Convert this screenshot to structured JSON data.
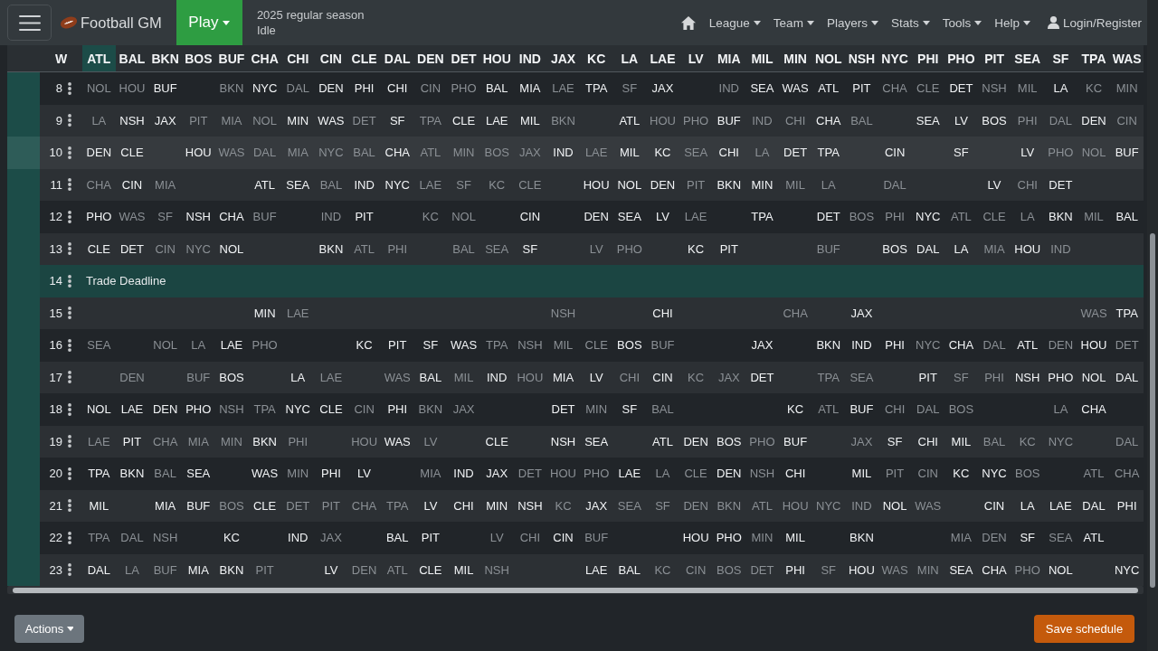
{
  "navbar": {
    "brand": "Football GM",
    "play": "Play",
    "season": "2025 regular season",
    "phase": "Idle",
    "menus": [
      "League",
      "Team",
      "Players",
      "Stats",
      "Tools",
      "Help"
    ],
    "login": "Login/Register"
  },
  "schedule": {
    "columns": [
      {
        "label": "W",
        "highlighted": false
      },
      {
        "label": "ATL",
        "highlighted": true
      },
      {
        "label": "BAL",
        "highlighted": false
      },
      {
        "label": "BKN",
        "highlighted": false
      },
      {
        "label": "BOS",
        "highlighted": false
      },
      {
        "label": "BUF",
        "highlighted": false
      },
      {
        "label": "CHA",
        "highlighted": false
      },
      {
        "label": "CHI",
        "highlighted": false
      },
      {
        "label": "CIN",
        "highlighted": false
      },
      {
        "label": "CLE",
        "highlighted": false
      },
      {
        "label": "DAL",
        "highlighted": false
      },
      {
        "label": "DEN",
        "highlighted": false
      },
      {
        "label": "DET",
        "highlighted": false
      },
      {
        "label": "HOU",
        "highlighted": false
      },
      {
        "label": "IND",
        "highlighted": false
      },
      {
        "label": "JAX",
        "highlighted": false
      },
      {
        "label": "KC",
        "highlighted": false
      },
      {
        "label": "LA",
        "highlighted": false
      },
      {
        "label": "LAE",
        "highlighted": false
      },
      {
        "label": "LV",
        "highlighted": false
      },
      {
        "label": "MIA",
        "highlighted": false
      },
      {
        "label": "MIL",
        "highlighted": false
      },
      {
        "label": "MIN",
        "highlighted": false
      },
      {
        "label": "NOL",
        "highlighted": false
      },
      {
        "label": "NSH",
        "highlighted": false
      },
      {
        "label": "NYC",
        "highlighted": false
      },
      {
        "label": "PHI",
        "highlighted": false
      },
      {
        "label": "PHO",
        "highlighted": false
      },
      {
        "label": "PIT",
        "highlighted": false
      },
      {
        "label": "SEA",
        "highlighted": false
      },
      {
        "label": "SF",
        "highlighted": false
      },
      {
        "label": "TPA",
        "highlighted": false
      },
      {
        "label": "WAS",
        "highlighted": false
      }
    ],
    "rows": [
      {
        "week": "8",
        "kind": "games",
        "hovered": false,
        "cells": [
          {
            "opponent": "NOL",
            "home": false
          },
          {
            "opponent": "HOU",
            "home": false
          },
          {
            "opponent": "BUF",
            "home": true
          },
          null,
          {
            "opponent": "BKN",
            "home": false
          },
          {
            "opponent": "NYC",
            "home": true
          },
          {
            "opponent": "DAL",
            "home": false
          },
          {
            "opponent": "DEN",
            "home": true
          },
          {
            "opponent": "PHI",
            "home": true
          },
          {
            "opponent": "CHI",
            "home": true
          },
          {
            "opponent": "CIN",
            "home": false
          },
          {
            "opponent": "PHO",
            "home": false
          },
          {
            "opponent": "BAL",
            "home": true
          },
          {
            "opponent": "MIA",
            "home": true
          },
          {
            "opponent": "LAE",
            "home": false
          },
          {
            "opponent": "TPA",
            "home": true
          },
          {
            "opponent": "SF",
            "home": false
          },
          {
            "opponent": "JAX",
            "home": true
          },
          null,
          {
            "opponent": "IND",
            "home": false
          },
          {
            "opponent": "SEA",
            "home": true
          },
          {
            "opponent": "WAS",
            "home": true
          },
          {
            "opponent": "ATL",
            "home": true
          },
          {
            "opponent": "PIT",
            "home": true
          },
          {
            "opponent": "CHA",
            "home": false
          },
          {
            "opponent": "CLE",
            "home": false
          },
          {
            "opponent": "DET",
            "home": true
          },
          {
            "opponent": "NSH",
            "home": false
          },
          {
            "opponent": "MIL",
            "home": false
          },
          {
            "opponent": "LA",
            "home": true
          },
          {
            "opponent": "KC",
            "home": false
          },
          {
            "opponent": "MIN",
            "home": false
          }
        ]
      },
      {
        "week": "9",
        "kind": "games",
        "hovered": false,
        "cells": [
          {
            "opponent": "LA",
            "home": false
          },
          {
            "opponent": "NSH",
            "home": true
          },
          {
            "opponent": "JAX",
            "home": true
          },
          {
            "opponent": "PIT",
            "home": false
          },
          {
            "opponent": "MIA",
            "home": false
          },
          {
            "opponent": "NOL",
            "home": false
          },
          {
            "opponent": "MIN",
            "home": true
          },
          {
            "opponent": "WAS",
            "home": true
          },
          {
            "opponent": "DET",
            "home": false
          },
          {
            "opponent": "SF",
            "home": true
          },
          {
            "opponent": "TPA",
            "home": false
          },
          {
            "opponent": "CLE",
            "home": true
          },
          {
            "opponent": "LAE",
            "home": true
          },
          {
            "opponent": "MIL",
            "home": true
          },
          {
            "opponent": "BKN",
            "home": false
          },
          null,
          {
            "opponent": "ATL",
            "home": true
          },
          {
            "opponent": "HOU",
            "home": false
          },
          {
            "opponent": "PHO",
            "home": false
          },
          {
            "opponent": "BUF",
            "home": true
          },
          {
            "opponent": "IND",
            "home": false
          },
          {
            "opponent": "CHI",
            "home": false
          },
          {
            "opponent": "CHA",
            "home": true
          },
          {
            "opponent": "BAL",
            "home": false
          },
          null,
          {
            "opponent": "SEA",
            "home": true
          },
          {
            "opponent": "LV",
            "home": true
          },
          {
            "opponent": "BOS",
            "home": true
          },
          {
            "opponent": "PHI",
            "home": false
          },
          {
            "opponent": "DAL",
            "home": false
          },
          {
            "opponent": "DEN",
            "home": true
          },
          {
            "opponent": "CIN",
            "home": false
          }
        ]
      },
      {
        "week": "10",
        "kind": "games",
        "hovered": true,
        "cells": [
          {
            "opponent": "DEN",
            "home": true
          },
          {
            "opponent": "CLE",
            "home": true
          },
          null,
          {
            "opponent": "HOU",
            "home": true
          },
          {
            "opponent": "WAS",
            "home": false
          },
          {
            "opponent": "DAL",
            "home": false
          },
          {
            "opponent": "MIA",
            "home": false
          },
          {
            "opponent": "NYC",
            "home": false
          },
          {
            "opponent": "BAL",
            "home": false
          },
          {
            "opponent": "CHA",
            "home": true
          },
          {
            "opponent": "ATL",
            "home": false
          },
          {
            "opponent": "MIN",
            "home": false
          },
          {
            "opponent": "BOS",
            "home": false
          },
          {
            "opponent": "JAX",
            "home": false
          },
          {
            "opponent": "IND",
            "home": true
          },
          {
            "opponent": "LAE",
            "home": false
          },
          {
            "opponent": "MIL",
            "home": true
          },
          {
            "opponent": "KC",
            "home": true
          },
          {
            "opponent": "SEA",
            "home": false
          },
          {
            "opponent": "CHI",
            "home": true
          },
          {
            "opponent": "LA",
            "home": false
          },
          {
            "opponent": "DET",
            "home": true
          },
          {
            "opponent": "TPA",
            "home": true
          },
          null,
          {
            "opponent": "CIN",
            "home": true
          },
          null,
          {
            "opponent": "SF",
            "home": true
          },
          null,
          {
            "opponent": "LV",
            "home": true
          },
          {
            "opponent": "PHO",
            "home": false
          },
          {
            "opponent": "NOL",
            "home": false
          },
          {
            "opponent": "BUF",
            "home": true
          }
        ]
      },
      {
        "week": "11",
        "kind": "games",
        "hovered": false,
        "cells": [
          {
            "opponent": "CHA",
            "home": false
          },
          {
            "opponent": "CIN",
            "home": true
          },
          {
            "opponent": "MIA",
            "home": false
          },
          null,
          null,
          {
            "opponent": "ATL",
            "home": true
          },
          {
            "opponent": "SEA",
            "home": true
          },
          {
            "opponent": "BAL",
            "home": false
          },
          {
            "opponent": "IND",
            "home": true
          },
          {
            "opponent": "NYC",
            "home": true
          },
          {
            "opponent": "LAE",
            "home": false
          },
          {
            "opponent": "SF",
            "home": false
          },
          {
            "opponent": "KC",
            "home": false
          },
          {
            "opponent": "CLE",
            "home": false
          },
          null,
          {
            "opponent": "HOU",
            "home": true
          },
          {
            "opponent": "NOL",
            "home": true
          },
          {
            "opponent": "DEN",
            "home": true
          },
          {
            "opponent": "PIT",
            "home": false
          },
          {
            "opponent": "BKN",
            "home": true
          },
          {
            "opponent": "MIN",
            "home": true
          },
          {
            "opponent": "MIL",
            "home": false
          },
          {
            "opponent": "LA",
            "home": false
          },
          null,
          {
            "opponent": "DAL",
            "home": false
          },
          null,
          null,
          {
            "opponent": "LV",
            "home": true
          },
          {
            "opponent": "CHI",
            "home": false
          },
          {
            "opponent": "DET",
            "home": true
          },
          null,
          null
        ]
      },
      {
        "week": "12",
        "kind": "games",
        "hovered": false,
        "cells": [
          {
            "opponent": "PHO",
            "home": true
          },
          {
            "opponent": "WAS",
            "home": false
          },
          {
            "opponent": "SF",
            "home": false
          },
          {
            "opponent": "NSH",
            "home": true
          },
          {
            "opponent": "CHA",
            "home": true
          },
          {
            "opponent": "BUF",
            "home": false
          },
          null,
          {
            "opponent": "IND",
            "home": false
          },
          {
            "opponent": "PIT",
            "home": true
          },
          null,
          {
            "opponent": "KC",
            "home": false
          },
          {
            "opponent": "NOL",
            "home": false
          },
          null,
          {
            "opponent": "CIN",
            "home": true
          },
          null,
          {
            "opponent": "DEN",
            "home": true
          },
          {
            "opponent": "SEA",
            "home": true
          },
          {
            "opponent": "LV",
            "home": true
          },
          {
            "opponent": "LAE",
            "home": false
          },
          null,
          {
            "opponent": "TPA",
            "home": true
          },
          null,
          {
            "opponent": "DET",
            "home": true
          },
          {
            "opponent": "BOS",
            "home": false
          },
          {
            "opponent": "PHI",
            "home": false
          },
          {
            "opponent": "NYC",
            "home": true
          },
          {
            "opponent": "ATL",
            "home": false
          },
          {
            "opponent": "CLE",
            "home": false
          },
          {
            "opponent": "LA",
            "home": false
          },
          {
            "opponent": "BKN",
            "home": true
          },
          {
            "opponent": "MIL",
            "home": false
          },
          {
            "opponent": "BAL",
            "home": true
          }
        ]
      },
      {
        "week": "13",
        "kind": "games",
        "hovered": false,
        "cells": [
          {
            "opponent": "CLE",
            "home": true
          },
          {
            "opponent": "DET",
            "home": true
          },
          {
            "opponent": "CIN",
            "home": false
          },
          {
            "opponent": "NYC",
            "home": false
          },
          {
            "opponent": "NOL",
            "home": true
          },
          null,
          null,
          {
            "opponent": "BKN",
            "home": true
          },
          {
            "opponent": "ATL",
            "home": false
          },
          {
            "opponent": "PHI",
            "home": false
          },
          null,
          {
            "opponent": "BAL",
            "home": false
          },
          {
            "opponent": "SEA",
            "home": false
          },
          {
            "opponent": "SF",
            "home": true
          },
          null,
          {
            "opponent": "LV",
            "home": false
          },
          {
            "opponent": "PHO",
            "home": false
          },
          null,
          {
            "opponent": "KC",
            "home": true
          },
          {
            "opponent": "PIT",
            "home": true
          },
          null,
          null,
          {
            "opponent": "BUF",
            "home": false
          },
          null,
          {
            "opponent": "BOS",
            "home": true
          },
          {
            "opponent": "DAL",
            "home": true
          },
          {
            "opponent": "LA",
            "home": true
          },
          {
            "opponent": "MIA",
            "home": false
          },
          {
            "opponent": "HOU",
            "home": true
          },
          {
            "opponent": "IND",
            "home": false
          },
          null,
          null
        ]
      },
      {
        "week": "14",
        "kind": "event",
        "hovered": false,
        "label": "Trade Deadline"
      },
      {
        "week": "15",
        "kind": "games",
        "hovered": false,
        "cells": [
          null,
          null,
          null,
          null,
          null,
          {
            "opponent": "MIN",
            "home": true
          },
          {
            "opponent": "LAE",
            "home": false
          },
          null,
          null,
          null,
          null,
          null,
          null,
          null,
          {
            "opponent": "NSH",
            "home": false
          },
          null,
          null,
          {
            "opponent": "CHI",
            "home": true
          },
          null,
          null,
          null,
          {
            "opponent": "CHA",
            "home": false
          },
          null,
          {
            "opponent": "JAX",
            "home": true
          },
          null,
          null,
          null,
          null,
          null,
          null,
          {
            "opponent": "WAS",
            "home": false
          },
          {
            "opponent": "TPA",
            "home": true
          }
        ]
      },
      {
        "week": "16",
        "kind": "games",
        "hovered": false,
        "cells": [
          {
            "opponent": "SEA",
            "home": false
          },
          null,
          {
            "opponent": "NOL",
            "home": false
          },
          {
            "opponent": "LA",
            "home": false
          },
          {
            "opponent": "LAE",
            "home": true
          },
          {
            "opponent": "PHO",
            "home": false
          },
          null,
          null,
          {
            "opponent": "KC",
            "home": true
          },
          {
            "opponent": "PIT",
            "home": true
          },
          {
            "opponent": "SF",
            "home": true
          },
          {
            "opponent": "WAS",
            "home": true
          },
          {
            "opponent": "TPA",
            "home": false
          },
          {
            "opponent": "NSH",
            "home": false
          },
          {
            "opponent": "MIL",
            "home": false
          },
          {
            "opponent": "CLE",
            "home": false
          },
          {
            "opponent": "BOS",
            "home": true
          },
          {
            "opponent": "BUF",
            "home": false
          },
          null,
          null,
          {
            "opponent": "JAX",
            "home": true
          },
          null,
          {
            "opponent": "BKN",
            "home": true
          },
          {
            "opponent": "IND",
            "home": true
          },
          {
            "opponent": "PHI",
            "home": true
          },
          {
            "opponent": "NYC",
            "home": false
          },
          {
            "opponent": "CHA",
            "home": true
          },
          {
            "opponent": "DAL",
            "home": false
          },
          {
            "opponent": "ATL",
            "home": true
          },
          {
            "opponent": "DEN",
            "home": false
          },
          {
            "opponent": "HOU",
            "home": true
          },
          {
            "opponent": "DET",
            "home": false
          }
        ]
      },
      {
        "week": "17",
        "kind": "games",
        "hovered": false,
        "cells": [
          null,
          {
            "opponent": "DEN",
            "home": false
          },
          null,
          {
            "opponent": "BUF",
            "home": false
          },
          {
            "opponent": "BOS",
            "home": true
          },
          null,
          {
            "opponent": "LA",
            "home": true
          },
          {
            "opponent": "LAE",
            "home": false
          },
          null,
          {
            "opponent": "WAS",
            "home": false
          },
          {
            "opponent": "BAL",
            "home": true
          },
          {
            "opponent": "MIL",
            "home": false
          },
          {
            "opponent": "IND",
            "home": true
          },
          {
            "opponent": "HOU",
            "home": false
          },
          {
            "opponent": "MIA",
            "home": true
          },
          {
            "opponent": "LV",
            "home": true
          },
          {
            "opponent": "CHI",
            "home": false
          },
          {
            "opponent": "CIN",
            "home": true
          },
          {
            "opponent": "KC",
            "home": false
          },
          {
            "opponent": "JAX",
            "home": false
          },
          {
            "opponent": "DET",
            "home": true
          },
          null,
          {
            "opponent": "TPA",
            "home": false
          },
          {
            "opponent": "SEA",
            "home": false
          },
          null,
          {
            "opponent": "PIT",
            "home": true
          },
          {
            "opponent": "SF",
            "home": false
          },
          {
            "opponent": "PHI",
            "home": false
          },
          {
            "opponent": "NSH",
            "home": true
          },
          {
            "opponent": "PHO",
            "home": true
          },
          {
            "opponent": "NOL",
            "home": true
          },
          {
            "opponent": "DAL",
            "home": true
          }
        ]
      },
      {
        "week": "18",
        "kind": "games",
        "hovered": false,
        "cells": [
          {
            "opponent": "NOL",
            "home": true
          },
          {
            "opponent": "LAE",
            "home": true
          },
          {
            "opponent": "DEN",
            "home": true
          },
          {
            "opponent": "PHO",
            "home": true
          },
          {
            "opponent": "NSH",
            "home": false
          },
          {
            "opponent": "TPA",
            "home": false
          },
          {
            "opponent": "NYC",
            "home": true
          },
          {
            "opponent": "CLE",
            "home": true
          },
          {
            "opponent": "CIN",
            "home": false
          },
          {
            "opponent": "PHI",
            "home": true
          },
          {
            "opponent": "BKN",
            "home": false
          },
          {
            "opponent": "JAX",
            "home": false
          },
          null,
          null,
          {
            "opponent": "DET",
            "home": true
          },
          {
            "opponent": "MIN",
            "home": false
          },
          {
            "opponent": "SF",
            "home": true
          },
          {
            "opponent": "BAL",
            "home": false
          },
          null,
          null,
          null,
          {
            "opponent": "KC",
            "home": true
          },
          {
            "opponent": "ATL",
            "home": false
          },
          {
            "opponent": "BUF",
            "home": true
          },
          {
            "opponent": "CHI",
            "home": false
          },
          {
            "opponent": "DAL",
            "home": false
          },
          {
            "opponent": "BOS",
            "home": false
          },
          null,
          null,
          {
            "opponent": "LA",
            "home": false
          },
          {
            "opponent": "CHA",
            "home": true
          },
          null
        ]
      },
      {
        "week": "19",
        "kind": "games",
        "hovered": false,
        "cells": [
          {
            "opponent": "LAE",
            "home": false
          },
          {
            "opponent": "PIT",
            "home": true
          },
          {
            "opponent": "CHA",
            "home": false
          },
          {
            "opponent": "MIA",
            "home": false
          },
          {
            "opponent": "MIN",
            "home": false
          },
          {
            "opponent": "BKN",
            "home": true
          },
          {
            "opponent": "PHI",
            "home": false
          },
          null,
          {
            "opponent": "HOU",
            "home": false
          },
          {
            "opponent": "WAS",
            "home": true
          },
          {
            "opponent": "LV",
            "home": false
          },
          null,
          {
            "opponent": "CLE",
            "home": true
          },
          null,
          {
            "opponent": "NSH",
            "home": true
          },
          {
            "opponent": "SEA",
            "home": true
          },
          null,
          {
            "opponent": "ATL",
            "home": true
          },
          {
            "opponent": "DEN",
            "home": true
          },
          {
            "opponent": "BOS",
            "home": true
          },
          {
            "opponent": "PHO",
            "home": false
          },
          {
            "opponent": "BUF",
            "home": true
          },
          null,
          {
            "opponent": "JAX",
            "home": false
          },
          {
            "opponent": "SF",
            "home": true
          },
          {
            "opponent": "CHI",
            "home": true
          },
          {
            "opponent": "MIL",
            "home": true
          },
          {
            "opponent": "BAL",
            "home": false
          },
          {
            "opponent": "KC",
            "home": false
          },
          {
            "opponent": "NYC",
            "home": false
          },
          null,
          {
            "opponent": "DAL",
            "home": false
          }
        ]
      },
      {
        "week": "20",
        "kind": "games",
        "hovered": false,
        "cells": [
          {
            "opponent": "TPA",
            "home": true
          },
          {
            "opponent": "BKN",
            "home": true
          },
          {
            "opponent": "BAL",
            "home": false
          },
          {
            "opponent": "SEA",
            "home": true
          },
          null,
          {
            "opponent": "WAS",
            "home": true
          },
          {
            "opponent": "MIN",
            "home": false
          },
          {
            "opponent": "PHI",
            "home": true
          },
          {
            "opponent": "LV",
            "home": true
          },
          null,
          {
            "opponent": "MIA",
            "home": false
          },
          {
            "opponent": "IND",
            "home": true
          },
          {
            "opponent": "JAX",
            "home": true
          },
          {
            "opponent": "DET",
            "home": false
          },
          {
            "opponent": "HOU",
            "home": false
          },
          {
            "opponent": "PHO",
            "home": false
          },
          {
            "opponent": "LAE",
            "home": true
          },
          {
            "opponent": "LA",
            "home": false
          },
          {
            "opponent": "CLE",
            "home": false
          },
          {
            "opponent": "DEN",
            "home": true
          },
          {
            "opponent": "NSH",
            "home": false
          },
          {
            "opponent": "CHI",
            "home": true
          },
          null,
          {
            "opponent": "MIL",
            "home": true
          },
          {
            "opponent": "PIT",
            "home": false
          },
          {
            "opponent": "CIN",
            "home": false
          },
          {
            "opponent": "KC",
            "home": true
          },
          {
            "opponent": "NYC",
            "home": true
          },
          {
            "opponent": "BOS",
            "home": false
          },
          null,
          {
            "opponent": "ATL",
            "home": false
          },
          {
            "opponent": "CHA",
            "home": false
          }
        ]
      },
      {
        "week": "21",
        "kind": "games",
        "hovered": false,
        "cells": [
          {
            "opponent": "MIL",
            "home": true
          },
          null,
          {
            "opponent": "MIA",
            "home": true
          },
          {
            "opponent": "BUF",
            "home": true
          },
          {
            "opponent": "BOS",
            "home": false
          },
          {
            "opponent": "CLE",
            "home": true
          },
          {
            "opponent": "DET",
            "home": false
          },
          {
            "opponent": "PIT",
            "home": false
          },
          {
            "opponent": "CHA",
            "home": false
          },
          {
            "opponent": "TPA",
            "home": false
          },
          {
            "opponent": "LV",
            "home": true
          },
          {
            "opponent": "CHI",
            "home": true
          },
          {
            "opponent": "MIN",
            "home": true
          },
          {
            "opponent": "NSH",
            "home": true
          },
          {
            "opponent": "KC",
            "home": false
          },
          {
            "opponent": "JAX",
            "home": true
          },
          {
            "opponent": "SEA",
            "home": false
          },
          {
            "opponent": "SF",
            "home": false
          },
          {
            "opponent": "DEN",
            "home": false
          },
          {
            "opponent": "BKN",
            "home": false
          },
          {
            "opponent": "ATL",
            "home": false
          },
          {
            "opponent": "HOU",
            "home": false
          },
          {
            "opponent": "NYC",
            "home": false
          },
          {
            "opponent": "IND",
            "home": false
          },
          {
            "opponent": "NOL",
            "home": true
          },
          {
            "opponent": "WAS",
            "home": false
          },
          null,
          {
            "opponent": "CIN",
            "home": true
          },
          {
            "opponent": "LA",
            "home": true
          },
          {
            "opponent": "LAE",
            "home": true
          },
          {
            "opponent": "DAL",
            "home": true
          },
          {
            "opponent": "PHI",
            "home": true
          }
        ]
      },
      {
        "week": "22",
        "kind": "games",
        "hovered": false,
        "cells": [
          {
            "opponent": "TPA",
            "home": false
          },
          {
            "opponent": "DAL",
            "home": false
          },
          {
            "opponent": "NSH",
            "home": false
          },
          null,
          {
            "opponent": "KC",
            "home": true
          },
          null,
          {
            "opponent": "IND",
            "home": true
          },
          {
            "opponent": "JAX",
            "home": false
          },
          null,
          {
            "opponent": "BAL",
            "home": true
          },
          {
            "opponent": "PIT",
            "home": true
          },
          null,
          {
            "opponent": "LV",
            "home": false
          },
          {
            "opponent": "CHI",
            "home": false
          },
          {
            "opponent": "CIN",
            "home": true
          },
          {
            "opponent": "BUF",
            "home": false
          },
          null,
          null,
          {
            "opponent": "HOU",
            "home": true
          },
          {
            "opponent": "PHO",
            "home": true
          },
          {
            "opponent": "MIN",
            "home": false
          },
          {
            "opponent": "MIL",
            "home": true
          },
          null,
          {
            "opponent": "BKN",
            "home": true
          },
          null,
          null,
          {
            "opponent": "MIA",
            "home": false
          },
          {
            "opponent": "DEN",
            "home": false
          },
          {
            "opponent": "SF",
            "home": true
          },
          {
            "opponent": "SEA",
            "home": false
          },
          {
            "opponent": "ATL",
            "home": true
          },
          null
        ]
      },
      {
        "week": "23",
        "kind": "games",
        "hovered": false,
        "cells": [
          {
            "opponent": "DAL",
            "home": true
          },
          {
            "opponent": "LA",
            "home": false
          },
          {
            "opponent": "BUF",
            "home": false
          },
          {
            "opponent": "MIA",
            "home": true
          },
          {
            "opponent": "BKN",
            "home": true
          },
          {
            "opponent": "PIT",
            "home": false
          },
          null,
          {
            "opponent": "LV",
            "home": true
          },
          {
            "opponent": "DEN",
            "home": false
          },
          {
            "opponent": "ATL",
            "home": false
          },
          {
            "opponent": "CLE",
            "home": true
          },
          {
            "opponent": "MIL",
            "home": true
          },
          {
            "opponent": "NSH",
            "home": false
          },
          null,
          null,
          {
            "opponent": "LAE",
            "home": true
          },
          {
            "opponent": "BAL",
            "home": true
          },
          {
            "opponent": "KC",
            "home": false
          },
          {
            "opponent": "CIN",
            "home": false
          },
          {
            "opponent": "BOS",
            "home": false
          },
          {
            "opponent": "DET",
            "home": false
          },
          {
            "opponent": "PHI",
            "home": true
          },
          {
            "opponent": "SF",
            "home": false
          },
          {
            "opponent": "HOU",
            "home": true
          },
          {
            "opponent": "WAS",
            "home": false
          },
          {
            "opponent": "MIN",
            "home": false
          },
          {
            "opponent": "SEA",
            "home": true
          },
          {
            "opponent": "CHA",
            "home": true
          },
          {
            "opponent": "PHO",
            "home": false
          },
          {
            "opponent": "NOL",
            "home": true
          },
          null,
          {
            "opponent": "NYC",
            "home": true
          }
        ]
      }
    ]
  },
  "footer": {
    "actions": "Actions",
    "save": "Save schedule"
  }
}
